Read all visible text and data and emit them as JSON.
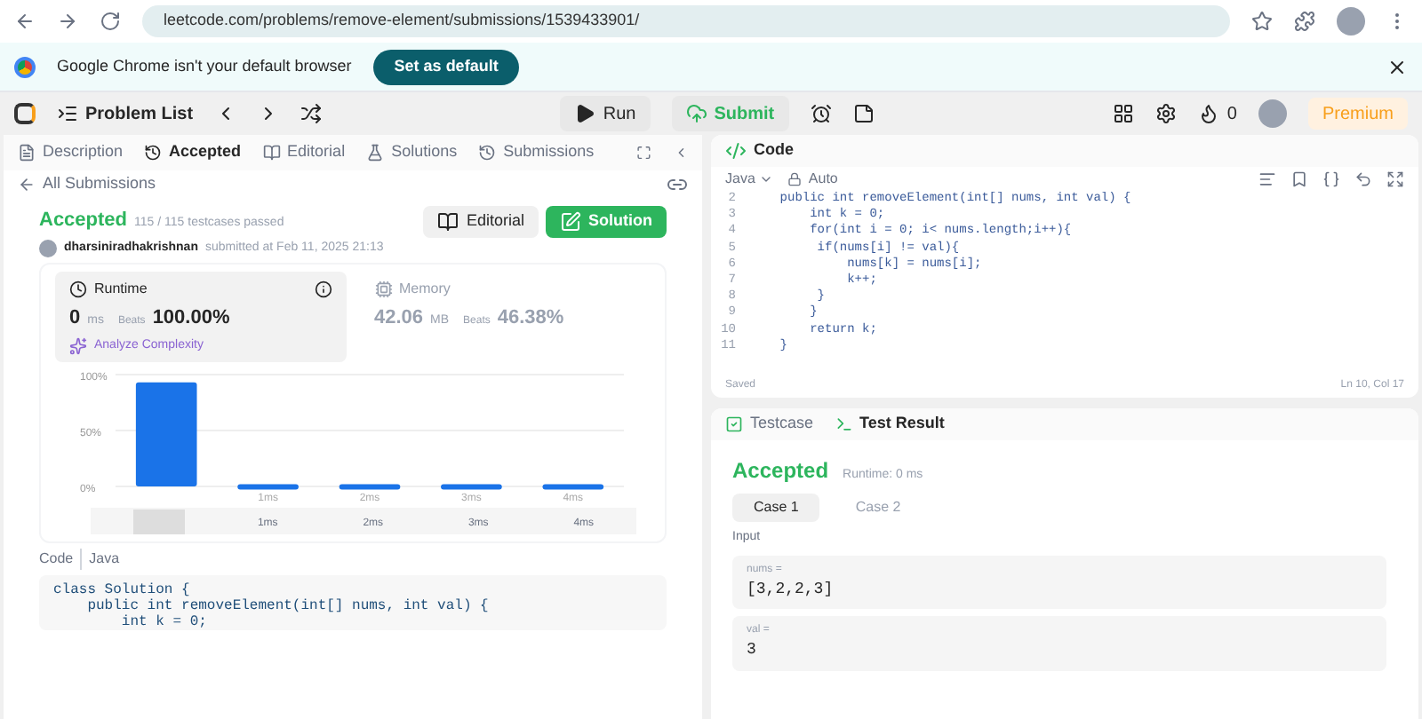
{
  "browser": {
    "url": "leetcode.com/problems/remove-element/submissions/1539433901/",
    "infobar": {
      "message": "Google Chrome isn't your default browser",
      "button": "Set as default"
    }
  },
  "toolbar": {
    "problem_list": "Problem List",
    "run": "Run",
    "submit": "Submit",
    "streak": "0",
    "premium": "Premium"
  },
  "left_panel": {
    "tabs": [
      {
        "label": "Description",
        "selected": false
      },
      {
        "label": "Accepted",
        "selected": true
      },
      {
        "label": "Editorial",
        "selected": false
      },
      {
        "label": "Solutions",
        "selected": false
      },
      {
        "label": "Submissions",
        "selected": false
      }
    ],
    "back_link": "All Submissions",
    "submission": {
      "status": "Accepted",
      "testcases": "115 / 115 testcases passed",
      "user": "dharsiniradhakrishnan",
      "submitted_at": "submitted at Feb 11, 2025 21:13",
      "editorial_button": "Editorial",
      "solution_button": "Solution"
    },
    "metrics": [
      {
        "label": "Runtime",
        "value": "0",
        "unit": "ms",
        "beats_label": "Beats",
        "beats": "100.00%",
        "selected": true,
        "link": "Analyze Complexity"
      },
      {
        "label": "Memory",
        "value": "42.06",
        "unit": "MB",
        "beats_label": "Beats",
        "beats": "46.38%",
        "selected": false
      }
    ],
    "chart_data": {
      "type": "bar",
      "categories": [
        null,
        "1ms",
        "2ms",
        "3ms",
        "4ms"
      ],
      "values": [
        93,
        2,
        2,
        2,
        2
      ],
      "ylim": [
        0,
        100
      ],
      "yticks": [
        {
          "value": 0,
          "label": "0%"
        },
        {
          "value": 50,
          "label": "50%"
        },
        {
          "value": 100,
          "label": "100%"
        }
      ]
    },
    "range": {
      "labels": [
        "1ms",
        "2ms",
        "3ms",
        "4ms"
      ],
      "level": 0.1
    },
    "code_header": {
      "label": "Code",
      "language": "Java"
    },
    "code_lines": [
      "class Solution {",
      "    public int removeElement(int[] nums, int val) {",
      "        int k = 0;"
    ]
  },
  "code_panel": {
    "title": "Code",
    "language": "Java",
    "mode": "Auto",
    "lines": [
      {
        "number": "2",
        "text": "    public int removeElement(int[] nums, int val) {"
      },
      {
        "number": "3",
        "text": "        int k = 0;"
      },
      {
        "number": "4",
        "text": "        for(int i = 0; i< nums.length;i++){"
      },
      {
        "number": "5",
        "text": "         if(nums[i] != val){"
      },
      {
        "number": "6",
        "text": "             nums[k] = nums[i];"
      },
      {
        "number": "7",
        "text": "             k++;"
      },
      {
        "number": "8",
        "text": "         }"
      },
      {
        "number": "9",
        "text": "        }"
      },
      {
        "number": "10",
        "text": "        return k;"
      },
      {
        "number": "11",
        "text": "    }"
      }
    ],
    "status": "Saved",
    "cursor": "Ln 10, Col 17"
  },
  "test_panel": {
    "tabs": [
      {
        "label": "Testcase",
        "selected": false
      },
      {
        "label": "Test Result",
        "selected": true
      }
    ],
    "status": "Accepted",
    "runtime": "Runtime: 0 ms",
    "cases": [
      {
        "label": "Case 1",
        "selected": true
      },
      {
        "label": "Case 2",
        "selected": false
      }
    ],
    "input_label": "Input",
    "inputs": [
      {
        "name": "nums =",
        "value": "[3,2,2,3]"
      },
      {
        "name": "val =",
        "value": "3"
      }
    ]
  }
}
